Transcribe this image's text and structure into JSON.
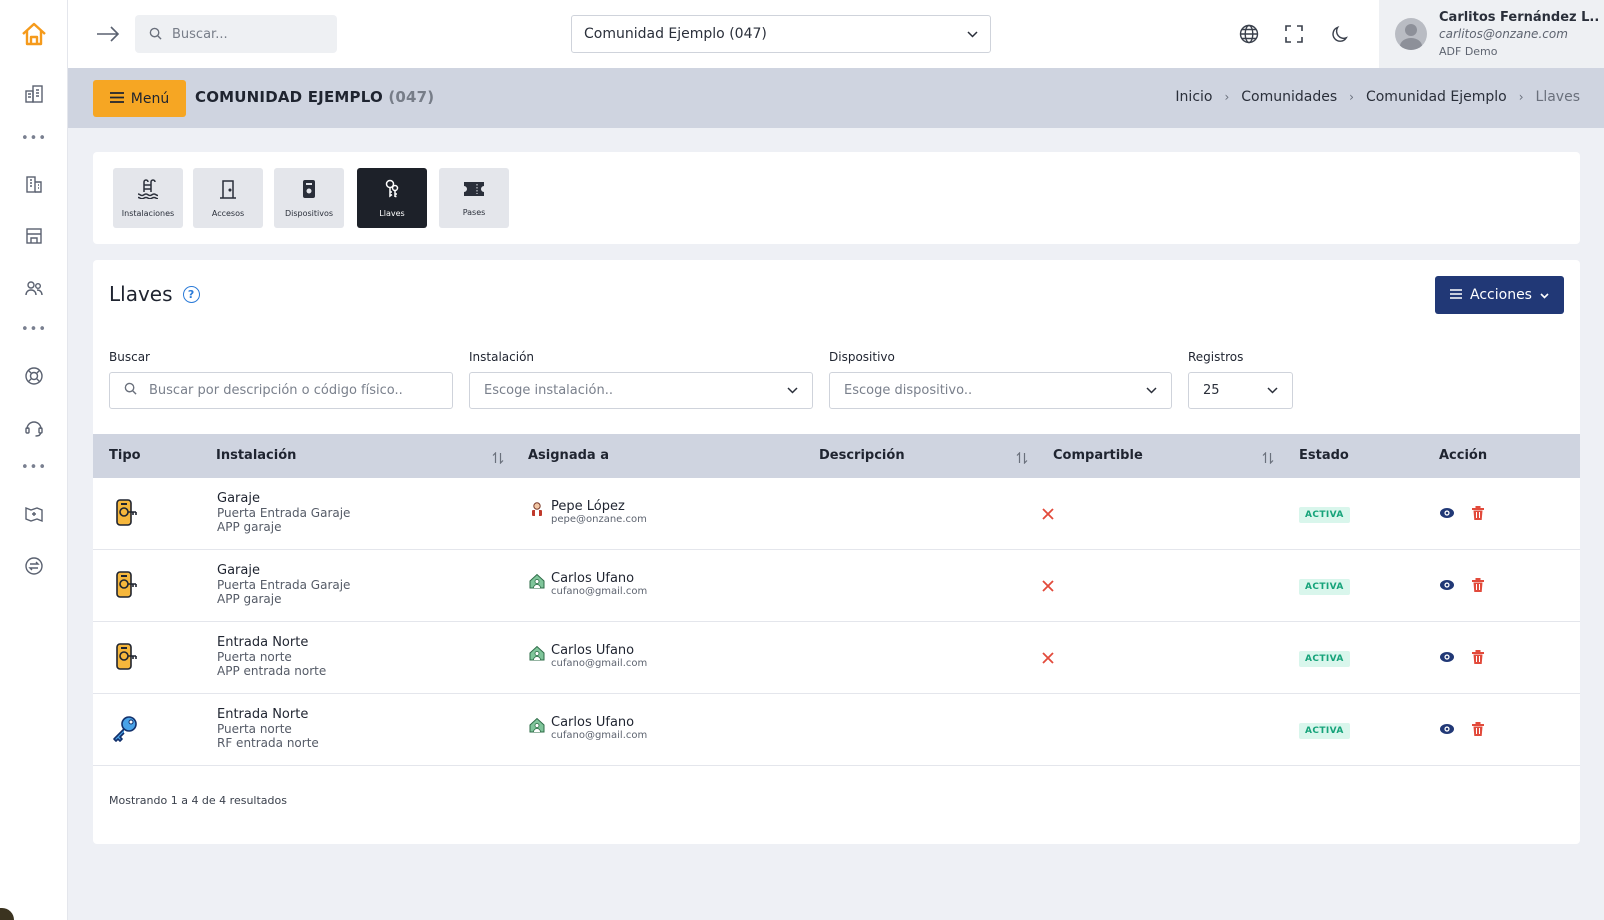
{
  "topbar": {
    "search_placeholder": "Buscar...",
    "community": "Comunidad Ejemplo (047)"
  },
  "user": {
    "name": "Carlitos Fernández L..",
    "email": "carlitos@onzane.com",
    "org": "ADF Demo"
  },
  "header": {
    "menu_label": "Menú",
    "title": "COMUNIDAD EJEMPLO",
    "title_code": "(047)",
    "breadcrumb": [
      "Inicio",
      "Comunidades",
      "Comunidad Ejemplo",
      "Llaves"
    ]
  },
  "tabs": [
    {
      "label": "Instalaciones",
      "icon": "pool-icon"
    },
    {
      "label": "Accesos",
      "icon": "door-icon"
    },
    {
      "label": "Dispositivos",
      "icon": "device-icon"
    },
    {
      "label": "Llaves",
      "icon": "keys-icon"
    },
    {
      "label": "Pases",
      "icon": "ticket-icon"
    }
  ],
  "section": {
    "title": "Llaves",
    "actions_label": "Acciones"
  },
  "filters": {
    "search": {
      "label": "Buscar",
      "placeholder": "Buscar por descripción o código físico.."
    },
    "installation": {
      "label": "Instalación",
      "placeholder": "Escoge instalación.."
    },
    "device": {
      "label": "Dispositivo",
      "placeholder": "Escoge dispositivo.."
    },
    "records": {
      "label": "Registros",
      "value": "25"
    }
  },
  "table": {
    "columns": [
      "Tipo",
      "Instalación",
      "Asignada a",
      "Descripción",
      "Compartible",
      "Estado",
      "Acción"
    ],
    "rows": [
      {
        "type": "app-key",
        "installation": "Garaje",
        "access": "Puerta Entrada Garaje",
        "device": "APP garaje",
        "user": "Pepe López",
        "email": "pepe@onzane.com",
        "shareable": false,
        "status": "ACTIVA"
      },
      {
        "type": "app-key",
        "installation": "Garaje",
        "access": "Puerta Entrada Garaje",
        "device": "APP garaje",
        "user": "Carlos Ufano",
        "email": "cufano@gmail.com",
        "shareable": false,
        "status": "ACTIVA"
      },
      {
        "type": "app-key",
        "installation": "Entrada Norte",
        "access": "Puerta norte",
        "device": "APP entrada norte",
        "user": "Carlos Ufano",
        "email": "cufano@gmail.com",
        "shareable": false,
        "status": "ACTIVA"
      },
      {
        "type": "rf-key",
        "installation": "Entrada Norte",
        "access": "Puerta norte",
        "device": "RF entrada norte",
        "user": "Carlos Ufano",
        "email": "cufano@gmail.com",
        "shareable": null,
        "status": "ACTIVA"
      }
    ]
  },
  "footer": {
    "summary": "Mostrando 1 a 4 de 4 resultados"
  },
  "colors": {
    "accent_orange": "#f6a623",
    "primary_navy": "#213876",
    "status_green": "#16a37a",
    "danger_red": "#e24a3b"
  }
}
